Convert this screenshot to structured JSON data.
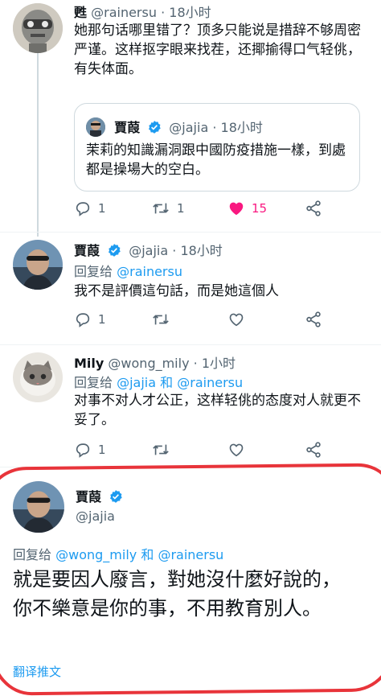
{
  "tweets": [
    {
      "name": "甦",
      "handle": "@rainersu",
      "time": "18小时",
      "text": "她那句话哪里错了？顶多只能说是措辞不够周密严谨。这样抠字眼来找茬，还揶揄得口气轻佻，有失体面。",
      "quote": {
        "name": "賈葭",
        "handle": "@jajia",
        "time": "18小时",
        "text": "茉莉的知識漏洞跟中國防疫措施一樣，到處都是操場大的空白。"
      },
      "replies": "1",
      "retweets": "1",
      "likes": "15",
      "liked": true
    },
    {
      "name": "賈葭",
      "handle": "@jajia",
      "time": "18小时",
      "reply_prefix": "回复给",
      "reply_to": "@rainersu",
      "text": "我不是評價這句話，而是她這個人",
      "replies": "1",
      "retweets": "",
      "likes": ""
    },
    {
      "name": "Mily",
      "handle": "@wong_mily",
      "time": "1小时",
      "reply_prefix": "回复给",
      "reply_to_1": "@jajia",
      "reply_and": "和",
      "reply_to_2": "@rainersu",
      "text": "对事不对人才公正，这样轻佻的态度对人就更不妥了。",
      "replies": "1",
      "retweets": "",
      "likes": ""
    }
  ],
  "main_tweet": {
    "name": "賈葭",
    "handle": "@jajia",
    "reply_prefix": "回复给",
    "reply_to_1": "@wong_mily",
    "reply_and": "和",
    "reply_to_2": "@rainersu",
    "text": "就是要因人廢言，對她沒什麼好說的，你不樂意是你的事，不用教育別人。",
    "translate": "翻译推文"
  },
  "colors": {
    "accent": "#1d9bf0",
    "like": "#f91880",
    "muted": "#536471",
    "annotation": "#e8343a"
  },
  "dot": "·"
}
